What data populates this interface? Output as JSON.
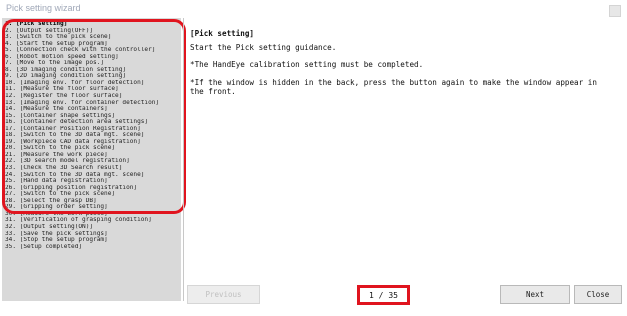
{
  "window": {
    "title": "Pick setting wizard"
  },
  "steps": [
    "1. [Pick setting]",
    "2. [Output setting(OFF)]",
    "3. [Switch to the pick scene]",
    "4. [Start the setup program]",
    "5. [Connection check with the controller]",
    "6. [Robot motion speed setting]",
    "7. [Move to the image pos.]",
    "8. [3D imaging condition setting]",
    "9. [2D imaging condition setting]",
    "10. [Imaging env. for floor detection]",
    "11. [Measure the floor surface]",
    "12. [Register the floor surface]",
    "13. [Imaging env. for container detection]",
    "14. [Measure the containers]",
    "15. [Container shape settings]",
    "16. [Container detection area settings]",
    "17. [Container Position Registration]",
    "18. [Switch to the 3D data mgt. scene]",
    "19. [Workpiece CAD data registration]",
    "20. [Switch to the pick scene]",
    "21. [Measure the work piece]",
    "22. [3D search model registration]",
    "23. [Check the 3D Search result]",
    "24. [Switch to the 3D data mgt. scene]",
    "25. [Hand data registration]",
    "26. [Gripping position registration]",
    "27. [Switch to the pick scene]",
    "28. [Select the grasp DB]",
    "29. [Gripping order setting]",
    "30. [Measure the work piece]",
    "31. [Verification of grasping condition]",
    "32. [Output setting(ON)]",
    "33. [Save the pick settings]",
    "34. [Stop the setup program]",
    "35. [Setup completed]"
  ],
  "content": {
    "heading": "[Pick setting]",
    "line1": "Start the Pick setting guidance.",
    "line2": "*The HandEye calibration setting must be completed.",
    "line3": "*If the window is hidden in the back, press the button again to make the window appear in the front."
  },
  "footer": {
    "previous_label": "Previous",
    "page_indicator": "1 / 35",
    "next_label": "Next",
    "close_label": "Close"
  },
  "colors": {
    "highlight": "#e0141e",
    "panel": "#d9d9d9"
  }
}
